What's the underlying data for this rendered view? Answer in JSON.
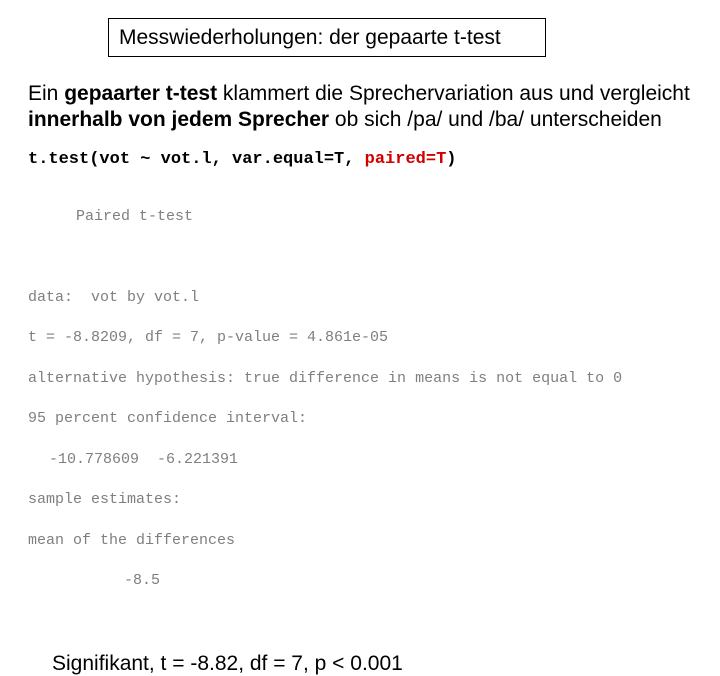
{
  "title": "Messwiederholungen: der gepaarte t-test",
  "explain": {
    "lead": "Ein ",
    "bold1": "gepaarter t-test",
    "mid1": " klammert die Sprechervariation aus und vergleicht ",
    "bold2": "innerhalb von jedem Sprecher",
    "mid2": " ob sich  /pa/ und /ba/ unterscheiden"
  },
  "code": {
    "call_plain": "t.test(vot ~ vot.l, var.equal=T, ",
    "call_red": "paired=T",
    "call_tail": ")"
  },
  "output": {
    "l1": "Paired t-test",
    "l2": "data:  vot by vot.l",
    "l3": "t = -8.8209, df = 7, p-value = 4.861e-05",
    "l4": "alternative hypothesis: true difference in means is not equal to 0",
    "l5": "95 percent confidence interval:",
    "l6": " -10.778609  -6.221391",
    "l7": "sample estimates:",
    "l8": "mean of the differences",
    "l9": "-8.5"
  },
  "conclusion": "Signifikant, t = -8.82, df = 7, p < 0.001"
}
